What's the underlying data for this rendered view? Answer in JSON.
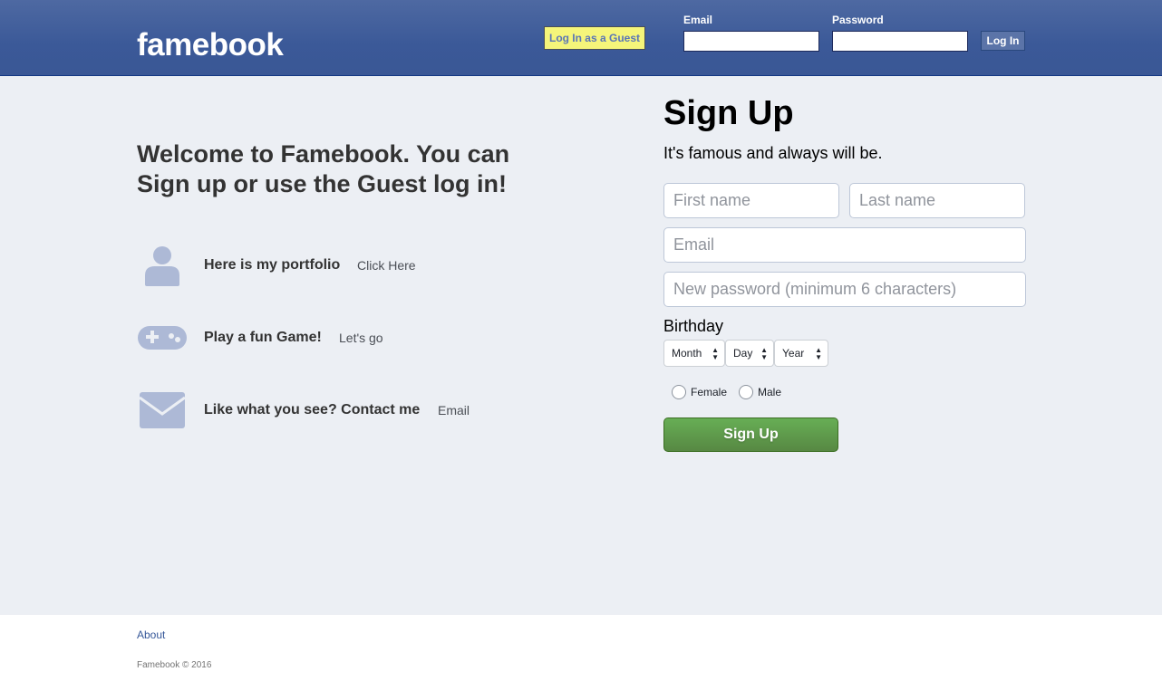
{
  "header": {
    "logo": "famebook",
    "guest_button": "Log In as a Guest",
    "email_label": "Email",
    "password_label": "Password",
    "email_value": "",
    "password_value": "",
    "login_button": "Log In"
  },
  "welcome": {
    "heading": "Welcome to Famebook. You can Sign up or use the Guest log in!"
  },
  "features": [
    {
      "icon": "person-icon",
      "title": "Here is my portfolio",
      "link": "Click Here"
    },
    {
      "icon": "gamepad-icon",
      "title": "Play a fun Game!",
      "link": "Let's go"
    },
    {
      "icon": "envelope-icon",
      "title": "Like what you see? Contact me",
      "link": "Email"
    }
  ],
  "signup": {
    "title": "Sign Up",
    "subtitle": "It's famous and always will be.",
    "first_name_placeholder": "First name",
    "last_name_placeholder": "Last name",
    "email_placeholder": "Email",
    "password_placeholder": "New password (minimum 6 characters)",
    "birthday_label": "Birthday",
    "month": "Month",
    "day": "Day",
    "year": "Year",
    "female": "Female",
    "male": "Male",
    "button": "Sign Up"
  },
  "footer": {
    "about": "About",
    "copyright": "Famebook © 2016"
  },
  "colors": {
    "header": "#3b5998",
    "guest_button": "#f5f57a",
    "signup_button": "#5fa04d",
    "icon": "#adb9d6"
  }
}
